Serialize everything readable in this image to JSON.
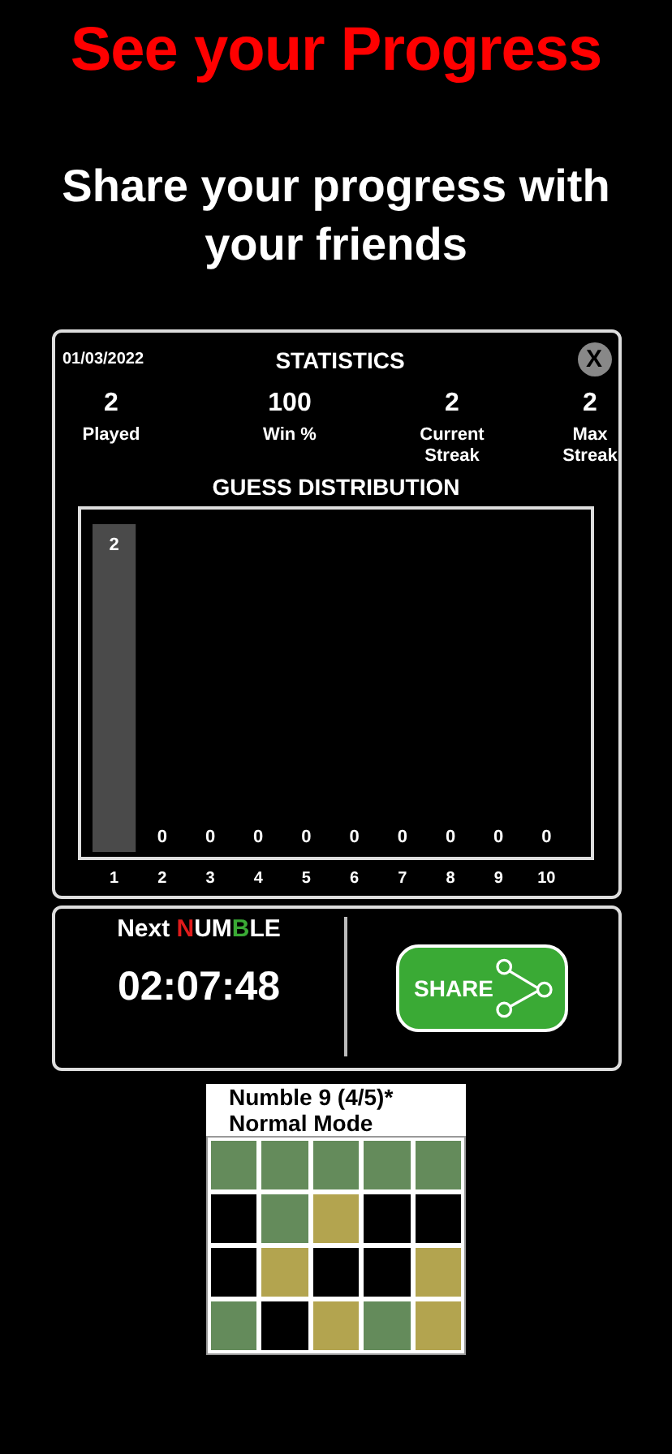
{
  "headline": "See your Progress",
  "subheadline": "Share your progress with your friends",
  "stats_card": {
    "date": "01/03/2022",
    "title": "STATISTICS",
    "close_label": "X",
    "stats": [
      {
        "value": "2",
        "label": "Played"
      },
      {
        "value": "100",
        "label": "Win %"
      },
      {
        "value": "2",
        "label": "Current Streak"
      },
      {
        "value": "2",
        "label": "Max Streak"
      }
    ],
    "distribution_title": "GUESS DISTRIBUTION",
    "chart_data": {
      "type": "bar",
      "categories": [
        "1",
        "2",
        "3",
        "4",
        "5",
        "6",
        "7",
        "8",
        "9",
        "10"
      ],
      "values": [
        2,
        0,
        0,
        0,
        0,
        0,
        0,
        0,
        0,
        0
      ],
      "data_labels": true
    }
  },
  "next_card": {
    "label_parts": [
      {
        "text": "Next ",
        "color": "#ffffff"
      },
      {
        "text": "N",
        "color": "#e01b1b"
      },
      {
        "text": "UM",
        "color": "#ffffff"
      },
      {
        "text": "B",
        "color": "#3aaa35"
      },
      {
        "text": "LE",
        "color": "#ffffff"
      }
    ],
    "countdown": "02:07:48",
    "share_label": "SHARE"
  },
  "share_preview": {
    "lines": [
      "Numble 9 (4/5)*",
      "Normal Mode"
    ],
    "rows": [
      [
        {
          "color": "#648b5b"
        },
        {
          "color": "#648b5b"
        },
        {
          "color": "#648b5b"
        },
        {
          "color": "#648b5b"
        },
        {
          "color": "#648b5b"
        }
      ],
      [
        {
          "color": "#000000"
        },
        {
          "color": "#648b5b"
        },
        {
          "color": "#b3a44f"
        },
        {
          "color": "#000000"
        },
        {
          "color": "#000000"
        }
      ],
      [
        {
          "color": "#000000"
        },
        {
          "color": "#b3a44f"
        },
        {
          "color": "#000000"
        },
        {
          "color": "#000000"
        },
        {
          "color": "#b3a44f"
        }
      ],
      [
        {
          "color": "#648b5b"
        },
        {
          "color": "#000000"
        },
        {
          "color": "#b3a44f"
        },
        {
          "color": "#648b5b"
        },
        {
          "color": "#b3a44f"
        }
      ]
    ]
  }
}
